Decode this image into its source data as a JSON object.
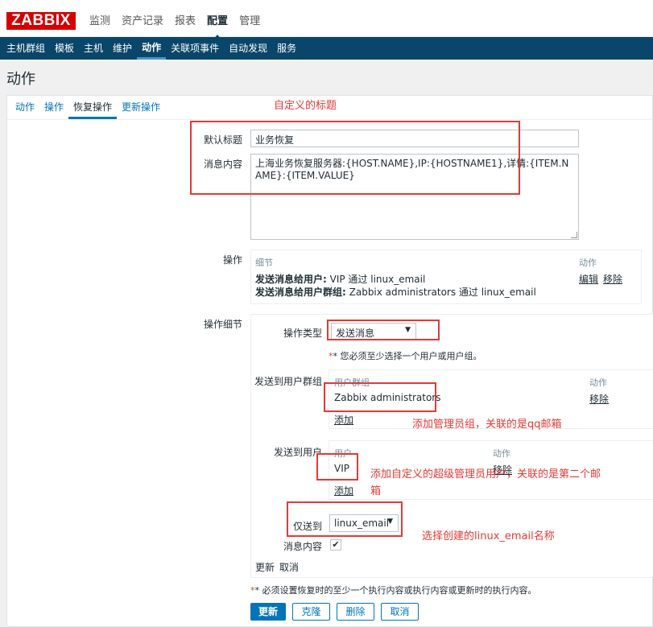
{
  "app": {
    "logo": "ZABBIX"
  },
  "main_nav": [
    {
      "label": "监测",
      "active": false
    },
    {
      "label": "资产记录",
      "active": false
    },
    {
      "label": "报表",
      "active": false
    },
    {
      "label": "配置",
      "active": true
    },
    {
      "label": "管理",
      "active": false
    }
  ],
  "sub_nav": [
    {
      "label": "主机群组",
      "active": false
    },
    {
      "label": "模板",
      "active": false
    },
    {
      "label": "主机",
      "active": false
    },
    {
      "label": "维护",
      "active": false
    },
    {
      "label": "动作",
      "active": true
    },
    {
      "label": "关联项事件",
      "active": false
    },
    {
      "label": "自动发现",
      "active": false
    },
    {
      "label": "服务",
      "active": false
    }
  ],
  "page": {
    "title": "动作"
  },
  "tabs": [
    {
      "label": "动作",
      "active": false
    },
    {
      "label": "操作",
      "active": false
    },
    {
      "label": "恢复操作",
      "active": true
    },
    {
      "label": "更新操作",
      "active": false
    }
  ],
  "form": {
    "default_subject_label": "默认标题",
    "default_subject_value": "业务恢复",
    "message_label": "消息内容",
    "message_value": "上海业务恢复服务器:{HOST.NAME},IP:{HOSTNAME1},详情:{ITEM.NAME}:{ITEM.VALUE}",
    "operations_label": "操作",
    "operations": {
      "col_details": "细节",
      "col_action": "动作",
      "rows": [
        {
          "prefix": "发送消息给用户:",
          "text": " VIP 通过 linux_email",
          "edit": "编辑",
          "remove": "移除"
        },
        {
          "prefix": "发送消息给用户群组:",
          "text": " Zabbix administrators 通过 linux_email"
        }
      ]
    },
    "op_details_label": "操作细节",
    "op_type_label": "操作类型",
    "op_type_value": "发送消息",
    "required_note": "* 您必须至少选择一个用户或用户组。",
    "send_to_groups_label": "发送到用户群组",
    "groups_table": {
      "col_group": "用户群组",
      "col_action": "动作",
      "rows": [
        {
          "name": "Zabbix administrators",
          "remove": "移除"
        }
      ],
      "add": "添加"
    },
    "send_to_users_label": "发送到用户",
    "users_table": {
      "col_user": "用户",
      "col_action": "动作",
      "rows": [
        {
          "name": "VIP",
          "remove": "移除"
        }
      ],
      "add": "添加"
    },
    "send_only_to_label": "仅送到",
    "send_only_to_value": "linux_email",
    "message_content_label": "消息内容",
    "message_content_checked": true,
    "update_link": "更新",
    "cancel_link": "取消",
    "bottom_note": "* 必须设置恢复时的至少一个执行内容或执行内容或更新时的执行内容。",
    "buttons": {
      "update": "更新",
      "clone": "克隆",
      "delete": "删除",
      "cancel": "取消"
    }
  },
  "annotations": {
    "custom_title": "自定义的标题",
    "admin_group": "添加管理员组，关联的是qq邮箱",
    "vip_user_line1": "添加自定义的超级管理员用户，关联的是第二个邮",
    "vip_user_line2": "箱",
    "media_type": "选择创建的linux_email名称"
  },
  "colors": {
    "brand": "#d40000",
    "nav_bg": "#0a466a",
    "link": "#0275b8",
    "annotation": "#e53935"
  }
}
